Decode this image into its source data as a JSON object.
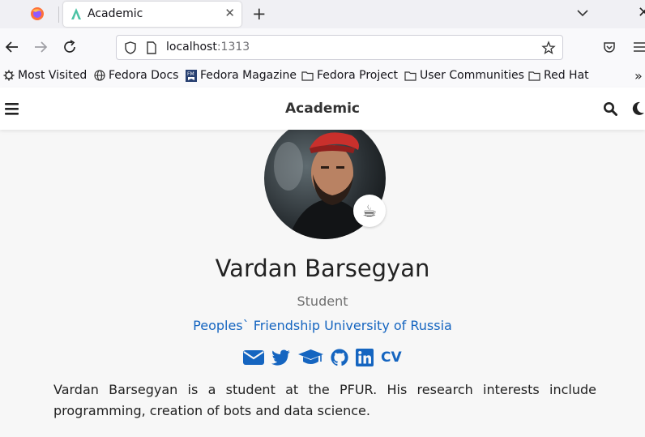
{
  "browser": {
    "tab_title": "Academic",
    "tab_close": "✕",
    "new_tab": "+",
    "window_close": "✕",
    "url_host": "localhost",
    "url_port": ":1313",
    "bookmarks": [
      {
        "label": "Most Visited",
        "icon": "gear-icon"
      },
      {
        "label": "Fedora Docs",
        "icon": "globe-icon"
      },
      {
        "label": "Fedora Magazine",
        "icon": "fm-icon"
      },
      {
        "label": "Fedora Project",
        "icon": "folder-icon"
      },
      {
        "label": "User Communities",
        "icon": "folder-icon"
      },
      {
        "label": "Red Hat",
        "icon": "folder-icon"
      }
    ],
    "bookmarks_more": "»"
  },
  "site": {
    "title": "Academic"
  },
  "profile": {
    "emoji": "☕",
    "name": "Vardan Barsegyan",
    "role": "Student",
    "organization": "Peoples` Friendship University of Russia",
    "social_icons": [
      "envelope-icon",
      "twitter-icon",
      "graduation-cap-icon",
      "github-icon",
      "linkedin-icon"
    ],
    "cv_label": "CV",
    "bio": "Vardan Barsegyan is a student at the PFUR. His research interests include programming, creation of bots and data science."
  },
  "colors": {
    "link": "#1565c0",
    "browser_bg": "#f0f0f4",
    "page_bg": "#f7f7f7"
  }
}
